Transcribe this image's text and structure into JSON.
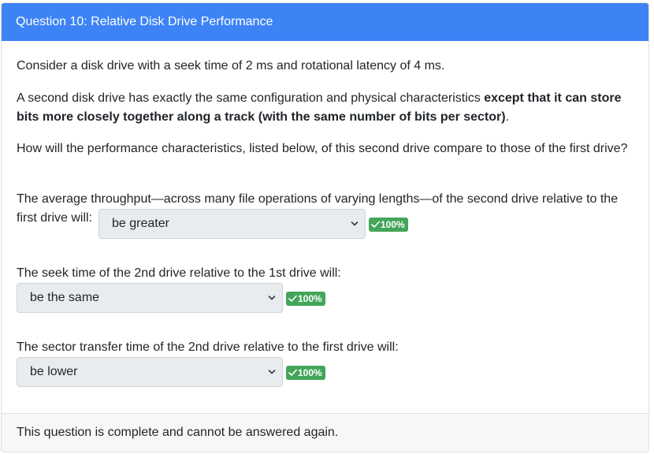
{
  "header": {
    "title": "Question 10: Relative Disk Drive Performance"
  },
  "question": {
    "p1": "Consider a disk drive with a seek time of 2 ms and rotational latency of 4 ms.",
    "p2_normal": "A second disk drive has exactly the same configuration and physical characteristics ",
    "p2_bold": "except that it can store bits more closely together along a track (with the same number of bits per sector)",
    "p2_end": ".",
    "p3": "How will the performance characteristics, listed below, of this second drive compare to those of the first drive?",
    "q1_prompt": "The average throughput—across many file operations of varying lengths—of the second drive relative to the first drive will:",
    "q1_value": "be greater",
    "q1_score": "100%",
    "q2_prompt": "The seek time of the 2nd drive relative to the 1st drive will:",
    "q2_value": "be the same",
    "q2_score": "100%",
    "q3_prompt": "The sector transfer time of the 2nd drive relative to the first drive will:",
    "q3_value": "be lower",
    "q3_score": "100%"
  },
  "footer": {
    "text": "This question is complete and cannot be answered again."
  },
  "colors": {
    "header_bg": "#3d83f6",
    "badge_bg": "#43a55a",
    "select_bg": "#e9ecef",
    "footer_bg": "#f7f7f7"
  },
  "icons": {
    "select_arrow": "chevron-down-icon",
    "badge_check": "check-icon"
  }
}
